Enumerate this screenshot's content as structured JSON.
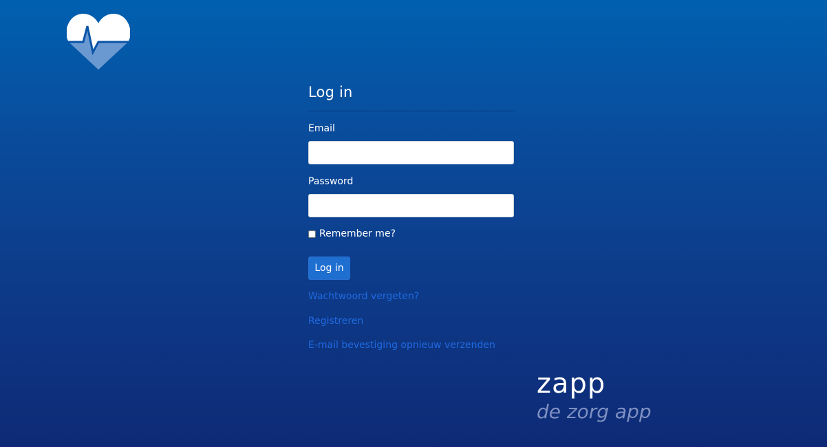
{
  "login_form": {
    "title": "Log in",
    "email_label": "Email",
    "email_value": "",
    "password_label": "Password",
    "password_value": "",
    "remember_label": "Remember me?",
    "remember_checked": false,
    "submit_label": "Log in"
  },
  "links": {
    "forgot_password": "Wachtwoord vergeten?",
    "register": "Registreren",
    "resend_confirmation": "E-mail bevestiging opnieuw verzenden"
  },
  "brand": {
    "name": "zapp",
    "tagline": "de zorg app",
    "logo_icon": "heart-pulse-icon"
  },
  "colors": {
    "background_top": "#0060b0",
    "background_bottom": "#0e2a76",
    "button": "#1f6fd0",
    "link": "#1f6ae0",
    "tagline": "#7e90c2"
  }
}
